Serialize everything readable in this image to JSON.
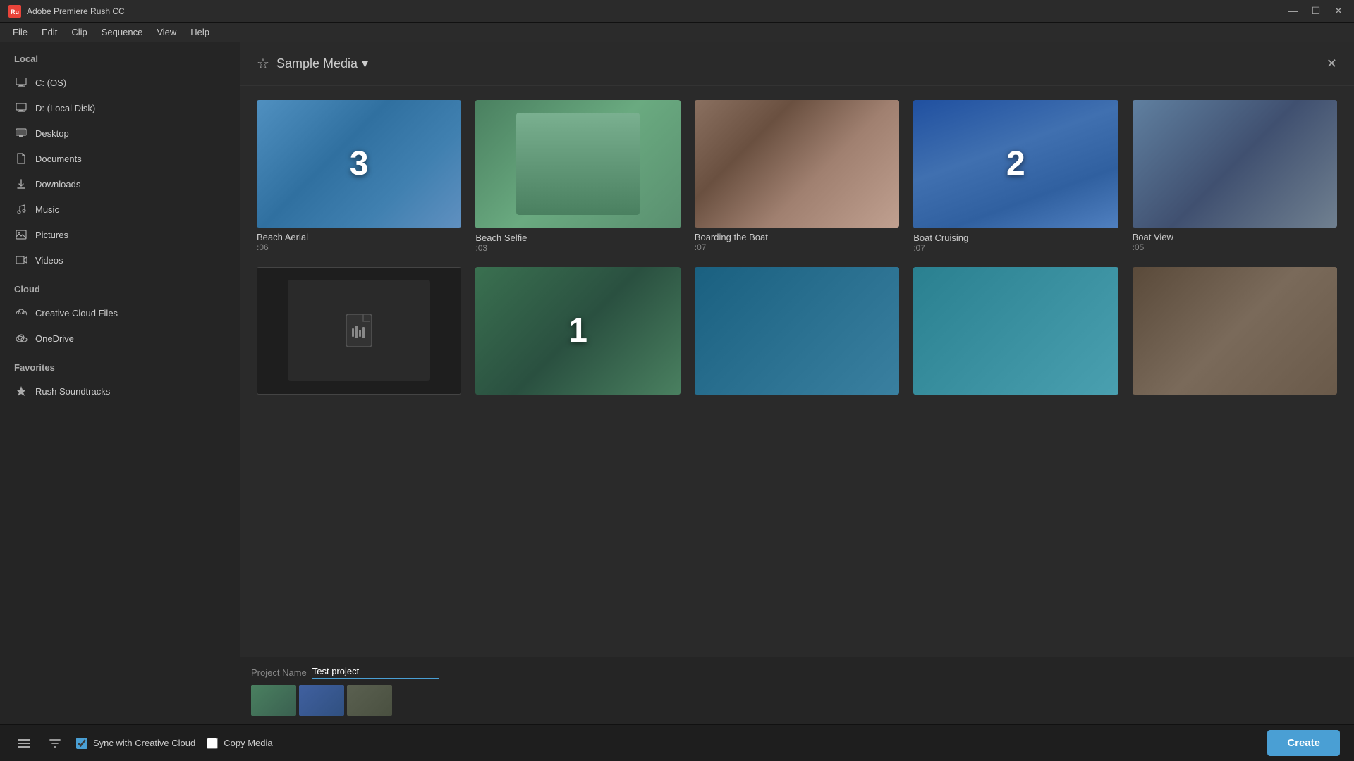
{
  "app": {
    "title": "Adobe Premiere Rush CC",
    "logo": "Ru"
  },
  "titlebar": {
    "minimize": "—",
    "maximize": "☐",
    "close": "✕"
  },
  "menubar": {
    "items": [
      "File",
      "Edit",
      "Clip",
      "Sequence",
      "View",
      "Help"
    ]
  },
  "sidebar": {
    "local_header": "Local",
    "local_items": [
      {
        "id": "c-os",
        "label": "C: (OS)",
        "icon": "monitor"
      },
      {
        "id": "d-local",
        "label": "D: (Local Disk)",
        "icon": "monitor"
      },
      {
        "id": "desktop",
        "label": "Desktop",
        "icon": "desktop"
      },
      {
        "id": "documents",
        "label": "Documents",
        "icon": "document"
      },
      {
        "id": "downloads",
        "label": "Downloads",
        "icon": "download"
      },
      {
        "id": "music",
        "label": "Music",
        "icon": "music"
      },
      {
        "id": "pictures",
        "label": "Pictures",
        "icon": "pictures"
      },
      {
        "id": "videos",
        "label": "Videos",
        "icon": "video"
      }
    ],
    "cloud_header": "Cloud",
    "cloud_items": [
      {
        "id": "cc-files",
        "label": "Creative Cloud Files",
        "icon": "cloud-circle"
      },
      {
        "id": "onedrive",
        "label": "OneDrive",
        "icon": "cloud"
      }
    ],
    "favorites_header": "Favorites",
    "favorites_items": [
      {
        "id": "rush-soundtracks",
        "label": "Rush Soundtracks",
        "icon": "star"
      }
    ]
  },
  "content": {
    "header_star": "☆",
    "header_title": "Sample Media",
    "header_dropdown": "▾",
    "header_close": "✕",
    "media_items": [
      {
        "id": "beach-aerial",
        "title": "Beach Aerial",
        "duration": ":06",
        "number": "3",
        "has_number": true,
        "type": "video",
        "thumb_class": "beach-aerial-bg"
      },
      {
        "id": "beach-selfie",
        "title": "Beach Selfie",
        "duration": ":03",
        "has_number": false,
        "type": "video",
        "thumb_class": "thumb-beach-selfie"
      },
      {
        "id": "boarding-the-boat",
        "title": "Boarding the Boat",
        "duration": ":07",
        "has_number": false,
        "type": "video",
        "thumb_class": "thumb-boarding"
      },
      {
        "id": "boat-cruising",
        "title": "Boat Cruising",
        "duration": ":07",
        "number": "2",
        "has_number": true,
        "type": "video",
        "thumb_class": "boat-cruising-bg"
      },
      {
        "id": "boat-view",
        "title": "Boat View",
        "duration": ":05",
        "has_number": false,
        "type": "video",
        "thumb_class": "thumb-boat-view"
      },
      {
        "id": "audio-file",
        "title": "",
        "duration": "",
        "has_number": false,
        "type": "audio",
        "thumb_class": "thumb-audio"
      },
      {
        "id": "cave-boat",
        "title": "",
        "duration": "",
        "number": "1",
        "has_number": true,
        "type": "video",
        "thumb_class": "cave-boat-bg"
      },
      {
        "id": "underwater",
        "title": "",
        "duration": "",
        "has_number": false,
        "type": "video",
        "thumb_class": "underwater-bg"
      },
      {
        "id": "underwater2",
        "title": "",
        "duration": "",
        "has_number": false,
        "type": "video",
        "thumb_class": "underwater2-bg"
      },
      {
        "id": "selfie2",
        "title": "",
        "duration": "",
        "has_number": false,
        "type": "video",
        "thumb_class": "thumb-selfie2"
      }
    ]
  },
  "bottom": {
    "project_name_label": "Project Name",
    "project_name_value": "Test project"
  },
  "footer": {
    "sync_label": "Sync with Creative Cloud",
    "copy_label": "Copy Media",
    "create_label": "Create"
  }
}
